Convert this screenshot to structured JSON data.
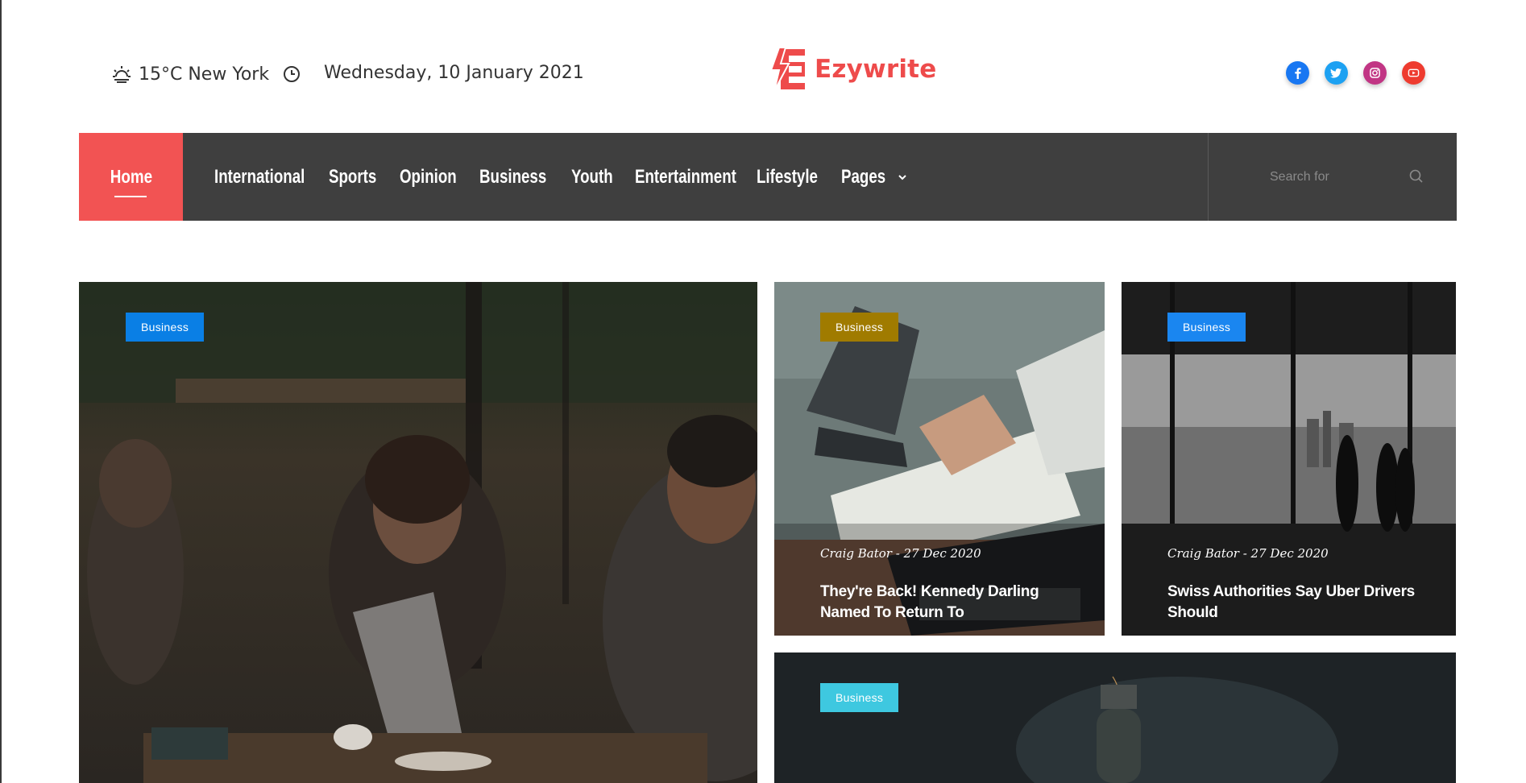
{
  "topbar": {
    "weather": "15°C New York",
    "date": "Wednesday, 10 January 2021"
  },
  "logo": {
    "text": "Ezywrite",
    "color": "#ee4b4b"
  },
  "socials": [
    {
      "name": "facebook-icon",
      "color": "#1877f2"
    },
    {
      "name": "twitter-icon",
      "color": "#1da1f2"
    },
    {
      "name": "instagram-icon",
      "color": "#c13584"
    },
    {
      "name": "youtube-icon",
      "color": "#ee3b2f"
    }
  ],
  "nav": {
    "home": "Home",
    "items": [
      "International",
      "Sports",
      "Opinion",
      "Business",
      "Youth",
      "Entertainment",
      "Lifestyle",
      "Pages"
    ],
    "search_placeholder": "Search for",
    "accent": "#f25353",
    "bg": "#3f3f3f"
  },
  "cards": {
    "main": {
      "badge": "Business",
      "badge_color": "#0a7fe5"
    },
    "top_middle": {
      "badge": "Business",
      "badge_color": "#a07b00",
      "meta": "Craig Bator - 27 Dec 2020",
      "title": "They're Back! Kennedy Darling Named To Return To"
    },
    "top_right": {
      "badge": "Business",
      "badge_color": "#1a86f0",
      "meta": "Craig Bator - 27 Dec 2020",
      "title": "Swiss Authorities Say Uber Drivers Should"
    },
    "bottom": {
      "badge": "Business",
      "badge_color": "#3ec8e0"
    }
  }
}
